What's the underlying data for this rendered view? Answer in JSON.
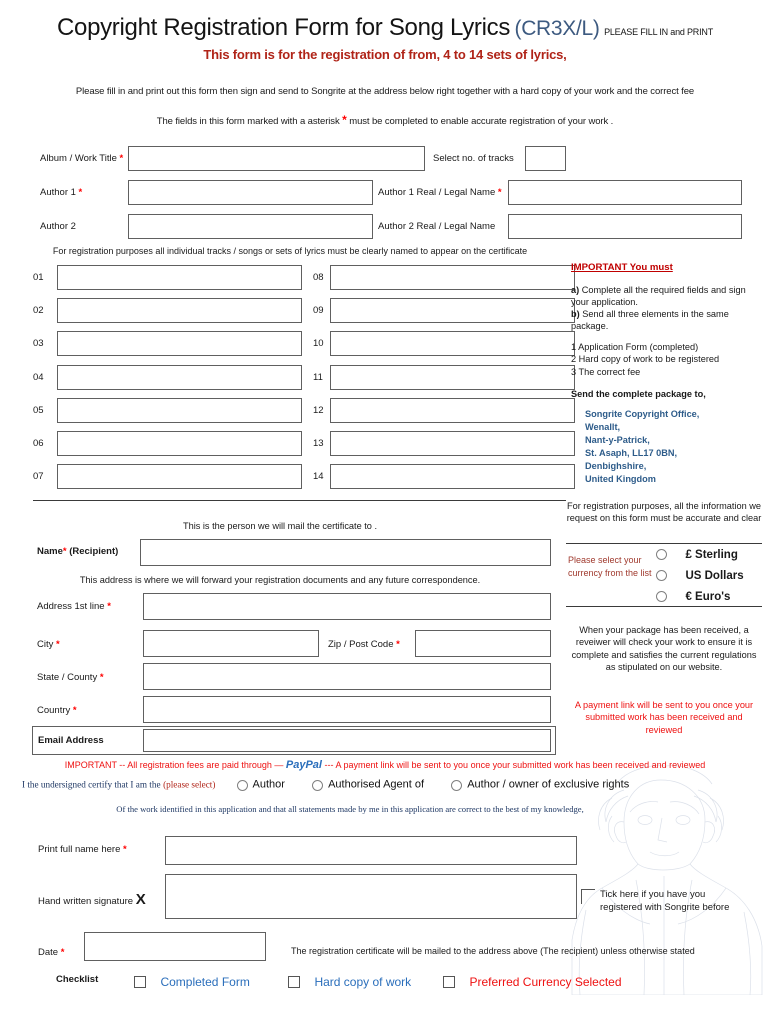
{
  "header": {
    "title_main": "Copyright Registration Form for Song Lyrics",
    "title_code": "(CR3X/L)",
    "title_print_note": "PLEASE FILL IN and PRINT",
    "subtitle": "This form is for the registration of from, 4 to 14 sets of lyrics,",
    "intro_line1": "Please fill in and print out this form then sign and send to Songrite at the address below right together with a hard copy of your work and the correct fee",
    "intro_line2_before": "The fields in this form marked with a asterisk",
    "intro_line2_asterisk": "*",
    "intro_line2_after": "must be completed to enable accurate registration of your work ."
  },
  "work": {
    "album_label": "Album / Work Title",
    "album_value": "",
    "tracks_label": "Select no. of tracks",
    "tracks_value": "",
    "author1_label": "Author 1",
    "author1_value": "",
    "author1_legal_label": "Author 1 Real / Legal Name",
    "author1_legal_value": "",
    "author2_label": "Author 2",
    "author2_value": "",
    "author2_legal_label": "Author 2 Real / Legal Name",
    "author2_legal_value": ""
  },
  "tracks": {
    "note": "For registration purposes all individual tracks / songs or sets of lyrics must be clearly named to appear on the certificate",
    "left": [
      {
        "num": "01",
        "value": ""
      },
      {
        "num": "02",
        "value": ""
      },
      {
        "num": "03",
        "value": ""
      },
      {
        "num": "04",
        "value": ""
      },
      {
        "num": "05",
        "value": ""
      },
      {
        "num": "06",
        "value": ""
      },
      {
        "num": "07",
        "value": ""
      }
    ],
    "right": [
      {
        "num": "08",
        "value": ""
      },
      {
        "num": "09",
        "value": ""
      },
      {
        "num": "10",
        "value": ""
      },
      {
        "num": "11",
        "value": ""
      },
      {
        "num": "12",
        "value": ""
      },
      {
        "num": "13",
        "value": ""
      },
      {
        "num": "14",
        "value": ""
      }
    ]
  },
  "sidebar": {
    "important_heading": "IMPORTANT  You must",
    "item_a_bold": "a)",
    "item_a_text": "Complete all the required fields and sign your application.",
    "item_b_bold": "b)",
    "item_b_text": "Send all three  elements in the same package.",
    "elements": [
      "1 Application Form (completed)",
      "2 Hard copy of work to be registered",
      "3 The correct fee"
    ],
    "send_to_label": "Send the complete package to,",
    "address": [
      "Songrite Copyright Office,",
      "Wenallt,",
      "Nant-y-Patrick,",
      "St. Asaph, LL17 0BN,",
      "Denbighshire,",
      "United Kingdom"
    ],
    "accuracy_note": "For registration purposes, all the information we request on this form must be accurate and clear",
    "currency_caption": "Please select your currency from the list",
    "currency_options": [
      "£ Sterling",
      "US Dollars",
      "€ Euro's"
    ],
    "review_note": "When your package has been received, a reveiwer will check your work to ensure it is complete and satisfies the current regulations as stipulated on our website.",
    "payment_note": "A payment link will be sent to you once your submitted work has been received and reviewed"
  },
  "recipient": {
    "note_certificate": "This is the person we will mail the certificate to .",
    "name_label": "Name",
    "name_suffix": "(Recipient)",
    "name_value": "",
    "note_address": "This address is where we will forward your registration documents and any future correspondence.",
    "address1_label": "Address 1st line",
    "address1_value": "",
    "city_label": "City",
    "city_value": "",
    "zip_label": "Zip  / Post Code",
    "zip_value": "",
    "state_label": "State / County",
    "state_value": "",
    "country_label": "Country",
    "country_value": "",
    "email_label": "Email Address",
    "email_value": ""
  },
  "declaration": {
    "paypal_before": "IMPORTANT -- All registration fees are paid through —",
    "paypal_word": "PayPal",
    "paypal_after": "--- A payment link will be sent to you once your submitted work has been received and reviewed",
    "undersigned_text": "I the undersigned certify that I am the",
    "please_select": "(please select)",
    "options": [
      "Author",
      "Authorised Agent of",
      "Author / owner of exclusive rights"
    ],
    "of_the_work": "Of the work identified in this application and that all statements made by me in this application are correct to the best of my knowledge,"
  },
  "signature": {
    "print_name_label": "Print full name here",
    "print_name_value": "",
    "handwritten_label": "Hand written signature",
    "handwritten_mark": "X",
    "handwritten_value": "",
    "tick_note": "Tick here if you have you registered with Songrite before",
    "date_label": "Date",
    "date_value": "",
    "mail_note": "The registration certificate will be mailed to the address above (The recipient)  unless otherwise stated"
  },
  "checklist": {
    "title": "Checklist",
    "items": [
      {
        "label": "Completed Form",
        "color": "#2a6ebb"
      },
      {
        "label": "Hard copy of work",
        "color": "#2a6ebb"
      },
      {
        "label": "Preferred Currency Selected",
        "color": "#ee1111"
      }
    ]
  },
  "colors": {
    "accent_red": "#b02418",
    "bright_red": "#ee1111",
    "link_blue": "#2e5c8a",
    "title_code_blue": "#3d5a80",
    "box_border": "#606060"
  }
}
